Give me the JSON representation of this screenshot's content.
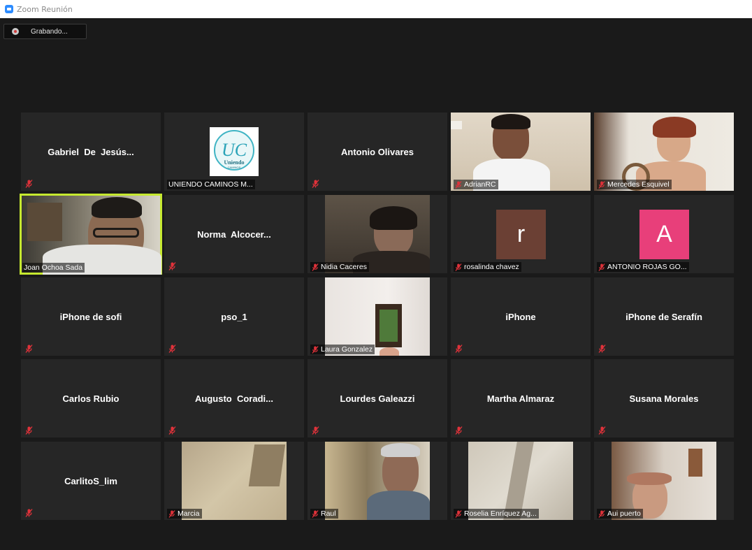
{
  "window": {
    "title": "Zoom Reunión"
  },
  "recording": {
    "label": "Grabando..."
  },
  "participants": [
    {
      "name": "Gabriel  De  Jesús...",
      "muted": true
    },
    {
      "name": "UNIENDO CAMINOS M...",
      "muted": false,
      "logo_text": "UC",
      "logo_sub": "Uniendo",
      "logo_sub2": "CAMINOS"
    },
    {
      "name": "Antonio Olivares",
      "muted": true
    },
    {
      "name": "AdrianRC",
      "muted": true
    },
    {
      "name": "Mercedes Esquivel",
      "muted": true
    },
    {
      "name": "Joan Ochoa Sada",
      "muted": false
    },
    {
      "name": "Norma  Alcocer...",
      "muted": true
    },
    {
      "name": "Nidia Caceres",
      "muted": true
    },
    {
      "name": "rosalinda chavez",
      "muted": true,
      "initial": "r",
      "avatar_color": "#6b4034"
    },
    {
      "name": "ANTONIO ROJAS GO...",
      "muted": true,
      "initial": "A",
      "avatar_color": "#e83f7a"
    },
    {
      "name": "iPhone de sofi",
      "muted": true
    },
    {
      "name": "pso_1",
      "muted": true
    },
    {
      "name": "Laura Gonzalez",
      "muted": true
    },
    {
      "name": "iPhone",
      "muted": true
    },
    {
      "name": "iPhone de Serafín",
      "muted": true
    },
    {
      "name": "Carlos Rubio",
      "muted": true
    },
    {
      "name": "Augusto  Coradi...",
      "muted": true
    },
    {
      "name": "Lourdes Galeazzi",
      "muted": true
    },
    {
      "name": "Martha Almaraz",
      "muted": true
    },
    {
      "name": "Susana Morales",
      "muted": true
    },
    {
      "name": "CarlitoS_lim",
      "muted": true
    },
    {
      "name": "Marcia",
      "muted": true
    },
    {
      "name": "Raul",
      "muted": true
    },
    {
      "name": "Roselia Enríquez Ag...",
      "muted": true
    },
    {
      "name": "Aui puerto",
      "muted": true
    }
  ],
  "colors": {
    "muted_mic": "#e0323a",
    "active_speaker": "#c6e92f",
    "tile_bg": "#262626"
  }
}
